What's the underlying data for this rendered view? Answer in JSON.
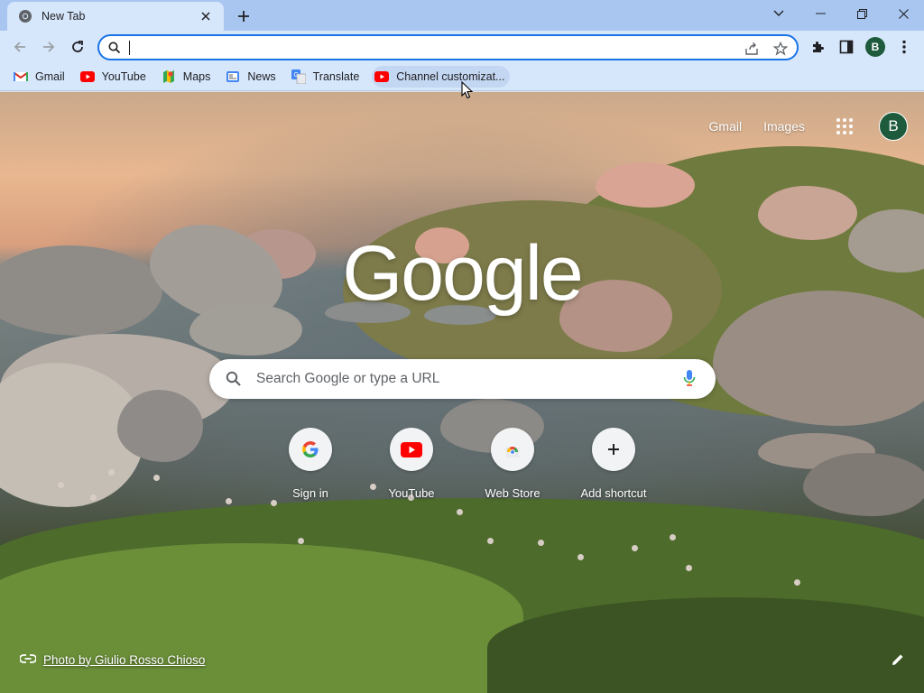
{
  "tab": {
    "title": "New Tab"
  },
  "toolbar": {
    "url": "",
    "profile_initial": "B"
  },
  "bookmarks": [
    {
      "label": "Gmail",
      "icon": "gmail-icon"
    },
    {
      "label": "YouTube",
      "icon": "youtube-icon"
    },
    {
      "label": "Maps",
      "icon": "maps-icon"
    },
    {
      "label": "News",
      "icon": "news-icon"
    },
    {
      "label": "Translate",
      "icon": "translate-icon"
    },
    {
      "label": "Channel customizat...",
      "icon": "youtube-icon"
    }
  ],
  "ntp": {
    "links": {
      "gmail": "Gmail",
      "images": "Images"
    },
    "avatar_initial": "B",
    "logo": "Google",
    "search_placeholder": "Search Google or type a URL",
    "shortcuts": [
      {
        "label": "Sign in",
        "icon": "google-g-icon"
      },
      {
        "label": "YouTube",
        "icon": "youtube-icon"
      },
      {
        "label": "Web Store",
        "icon": "web-store-icon"
      },
      {
        "label": "Add shortcut",
        "icon": "plus-icon"
      }
    ],
    "photo_credit": "Photo by Giulio Rosso Chioso"
  },
  "colors": {
    "tabstrip": "#a9c6f0",
    "toolbar": "#d6e6fb",
    "accent": "#1a73e8",
    "profile": "#1e5a3c"
  }
}
